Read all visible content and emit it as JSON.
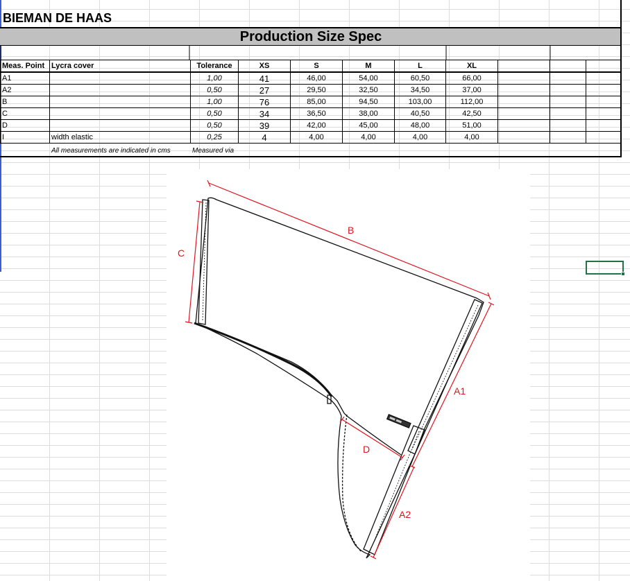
{
  "brand": "BIEMAN DE HAAS",
  "title": "Production Size Spec",
  "table": {
    "headers": {
      "point": "Meas. Point",
      "desc": "Lycra cover",
      "tolerance": "Tolerance",
      "sizes": [
        "XS",
        "S",
        "M",
        "L",
        "XL"
      ]
    },
    "rows": [
      {
        "point": "A1",
        "desc": "",
        "tolerance": "1,00",
        "values": [
          "41",
          "46,00",
          "54,00",
          "60,50",
          "66,00"
        ]
      },
      {
        "point": "A2",
        "desc": "",
        "tolerance": "0,50",
        "values": [
          "27",
          "29,50",
          "32,50",
          "34,50",
          "37,00"
        ]
      },
      {
        "point": "B",
        "desc": "",
        "tolerance": "1,00",
        "values": [
          "76",
          "85,00",
          "94,50",
          "103,00",
          "112,00"
        ]
      },
      {
        "point": "C",
        "desc": "",
        "tolerance": "0,50",
        "values": [
          "34",
          "36,50",
          "38,00",
          "40,50",
          "42,50"
        ]
      },
      {
        "point": "D",
        "desc": "",
        "tolerance": "0,50",
        "values": [
          "39",
          "42,00",
          "45,00",
          "48,00",
          "51,00"
        ]
      },
      {
        "point": "I",
        "desc": "width elastic",
        "tolerance": "0,25",
        "values": [
          "4",
          "4,00",
          "4,00",
          "4,00",
          "4,00"
        ]
      }
    ],
    "note": "All measurements are indicated in cms",
    "note2": "Measured via"
  },
  "diagram": {
    "labels": {
      "A1": "A1",
      "A2": "A2",
      "B": "B",
      "C": "C",
      "D": "D"
    },
    "measure_color": "#e0141e",
    "outline_color": "#111111"
  }
}
